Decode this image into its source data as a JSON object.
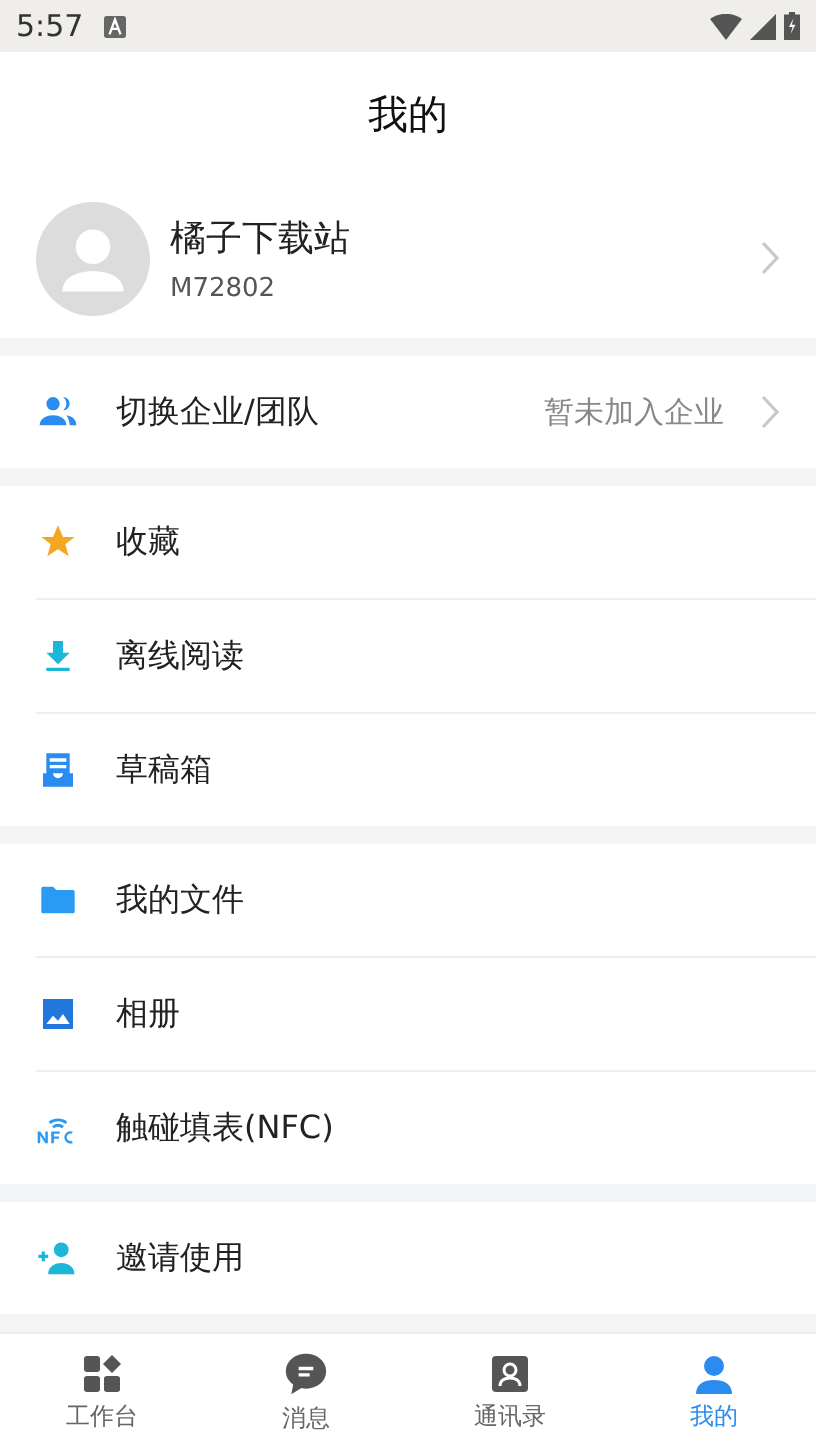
{
  "status_bar": {
    "time": "5:57"
  },
  "header": {
    "title": "我的"
  },
  "profile": {
    "name": "橘子下载站",
    "id": "M72802"
  },
  "sections": [
    {
      "items": [
        {
          "kind": "team",
          "label": "切换企业/团队",
          "value": "暂未加入企业"
        }
      ]
    },
    {
      "items": [
        {
          "kind": "star",
          "label": "收藏"
        },
        {
          "kind": "download",
          "label": "离线阅读"
        },
        {
          "kind": "drafts",
          "label": "草稿箱"
        }
      ]
    },
    {
      "items": [
        {
          "kind": "folder",
          "label": "我的文件"
        },
        {
          "kind": "album",
          "label": "相册"
        },
        {
          "kind": "nfc",
          "label": "触碰填表(NFC)"
        }
      ]
    },
    {
      "items": [
        {
          "kind": "invite",
          "label": "邀请使用"
        }
      ]
    }
  ],
  "tab_bar": [
    {
      "kind": "grid",
      "label": "工作台",
      "selected": false
    },
    {
      "kind": "chat",
      "label": "消息",
      "selected": false
    },
    {
      "kind": "contacts",
      "label": "通讯录",
      "selected": false
    },
    {
      "kind": "person",
      "label": "我的",
      "selected": true
    }
  ]
}
